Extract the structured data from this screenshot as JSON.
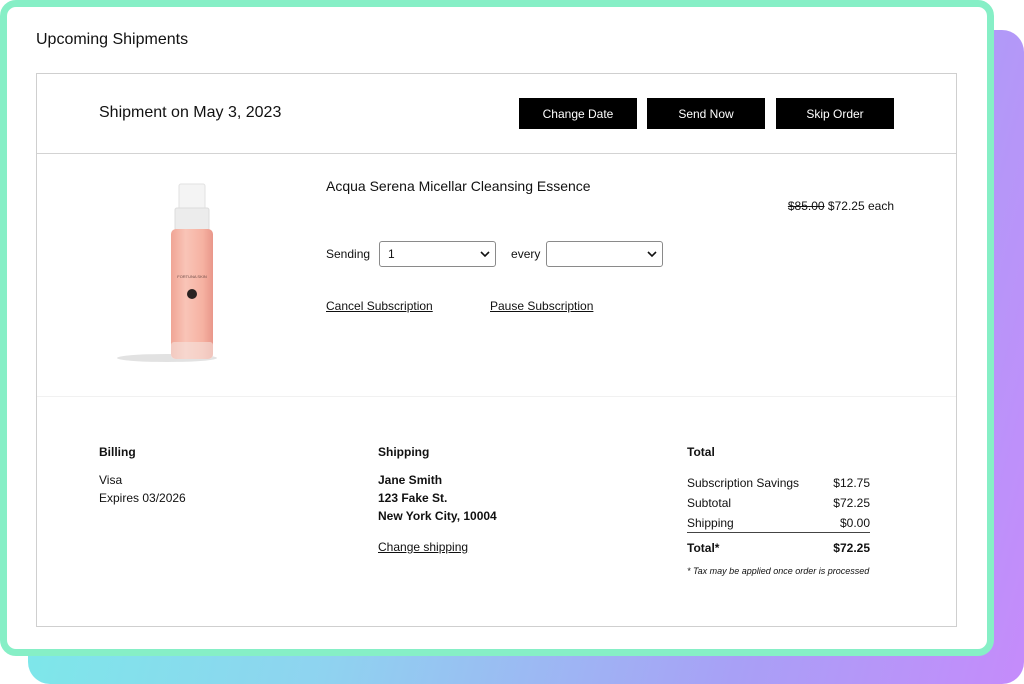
{
  "page_title": "Upcoming Shipments",
  "shipment": {
    "date_label": "Shipment on May 3, 2023",
    "buttons": {
      "change_date": "Change Date",
      "send_now": "Send Now",
      "skip_order": "Skip Order"
    }
  },
  "product": {
    "name": "Acqua Serena Micellar Cleansing Essence",
    "price_original": "$85.00",
    "price_current": "$72.25",
    "price_unit": "each",
    "bottle_label_brand": "FORTUNA SKIN",
    "sending_label": "Sending",
    "quantity_value": "1",
    "every_label": "every",
    "frequency_value": "",
    "cancel_link": "Cancel Subscription",
    "pause_link": "Pause Subscription"
  },
  "billing": {
    "title": "Billing",
    "card": "Visa",
    "expires": "Expires 03/2026"
  },
  "shipping": {
    "title": "Shipping",
    "name": "Jane Smith",
    "street": "123 Fake St.",
    "city": "New York City, 10004",
    "change_link": "Change shipping"
  },
  "totals": {
    "title": "Total",
    "rows": [
      {
        "label": "Subscription Savings",
        "value": "$12.75"
      },
      {
        "label": "Subtotal",
        "value": "$72.25"
      },
      {
        "label": "Shipping",
        "value": "$0.00"
      }
    ],
    "total_label": "Total*",
    "total_value": "$72.25",
    "tax_note": "* Tax may be applied once order is processed"
  },
  "colors": {
    "card_border": "#86efc6",
    "gradient_start": "#74f2e6",
    "gradient_end": "#c58bfb",
    "button_bg": "#000000",
    "bottle_fill": "#f6b7a8"
  }
}
